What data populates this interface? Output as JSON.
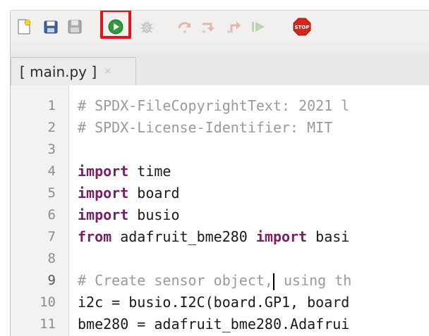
{
  "toolbar": {
    "buttons": [
      {
        "name": "new-file",
        "icon": "new-file-icon"
      },
      {
        "name": "open-file",
        "icon": "open-file-icon"
      },
      {
        "name": "save-file",
        "icon": "save-file-icon"
      },
      {
        "name": "run",
        "icon": "run-icon",
        "highlighted": true
      },
      {
        "name": "debug",
        "icon": "bug-icon"
      },
      {
        "name": "step-over",
        "icon": "step-over-icon"
      },
      {
        "name": "step-into",
        "icon": "step-into-icon"
      },
      {
        "name": "step-out",
        "icon": "step-out-icon"
      },
      {
        "name": "resume",
        "icon": "resume-icon"
      },
      {
        "name": "stop",
        "icon": "stop-icon",
        "label": "STOP"
      }
    ],
    "highlight_color": "#e8121a"
  },
  "tabs": [
    {
      "label": "[ main.py ]",
      "close": "×"
    }
  ],
  "editor": {
    "lines": [
      {
        "num": "1",
        "text": "# SPDX-FileCopyrightText: 2021 l"
      },
      {
        "num": "2",
        "text": "# SPDX-License-Identifier: MIT"
      },
      {
        "num": "3",
        "text": ""
      },
      {
        "num": "4",
        "kw": "import",
        "rest": " time"
      },
      {
        "num": "5",
        "kw": "import",
        "rest": " board"
      },
      {
        "num": "6",
        "kw": "import",
        "rest": " busio"
      },
      {
        "num": "7",
        "kw": "from",
        "mid": " adafruit_bme280 ",
        "kw2": "import",
        "rest": " basi"
      },
      {
        "num": "8",
        "text": ""
      },
      {
        "num": "9",
        "pre": "# Create sensor object,",
        "post": " using th"
      },
      {
        "num": "10",
        "text": "i2c = busio.I2C(board.GP1, board"
      },
      {
        "num": "11",
        "text": "bme280 = adafruit_bme280.Adafrui"
      }
    ],
    "colors": {
      "comment": "#9a9a9a",
      "keyword": "#7a1f66"
    }
  }
}
